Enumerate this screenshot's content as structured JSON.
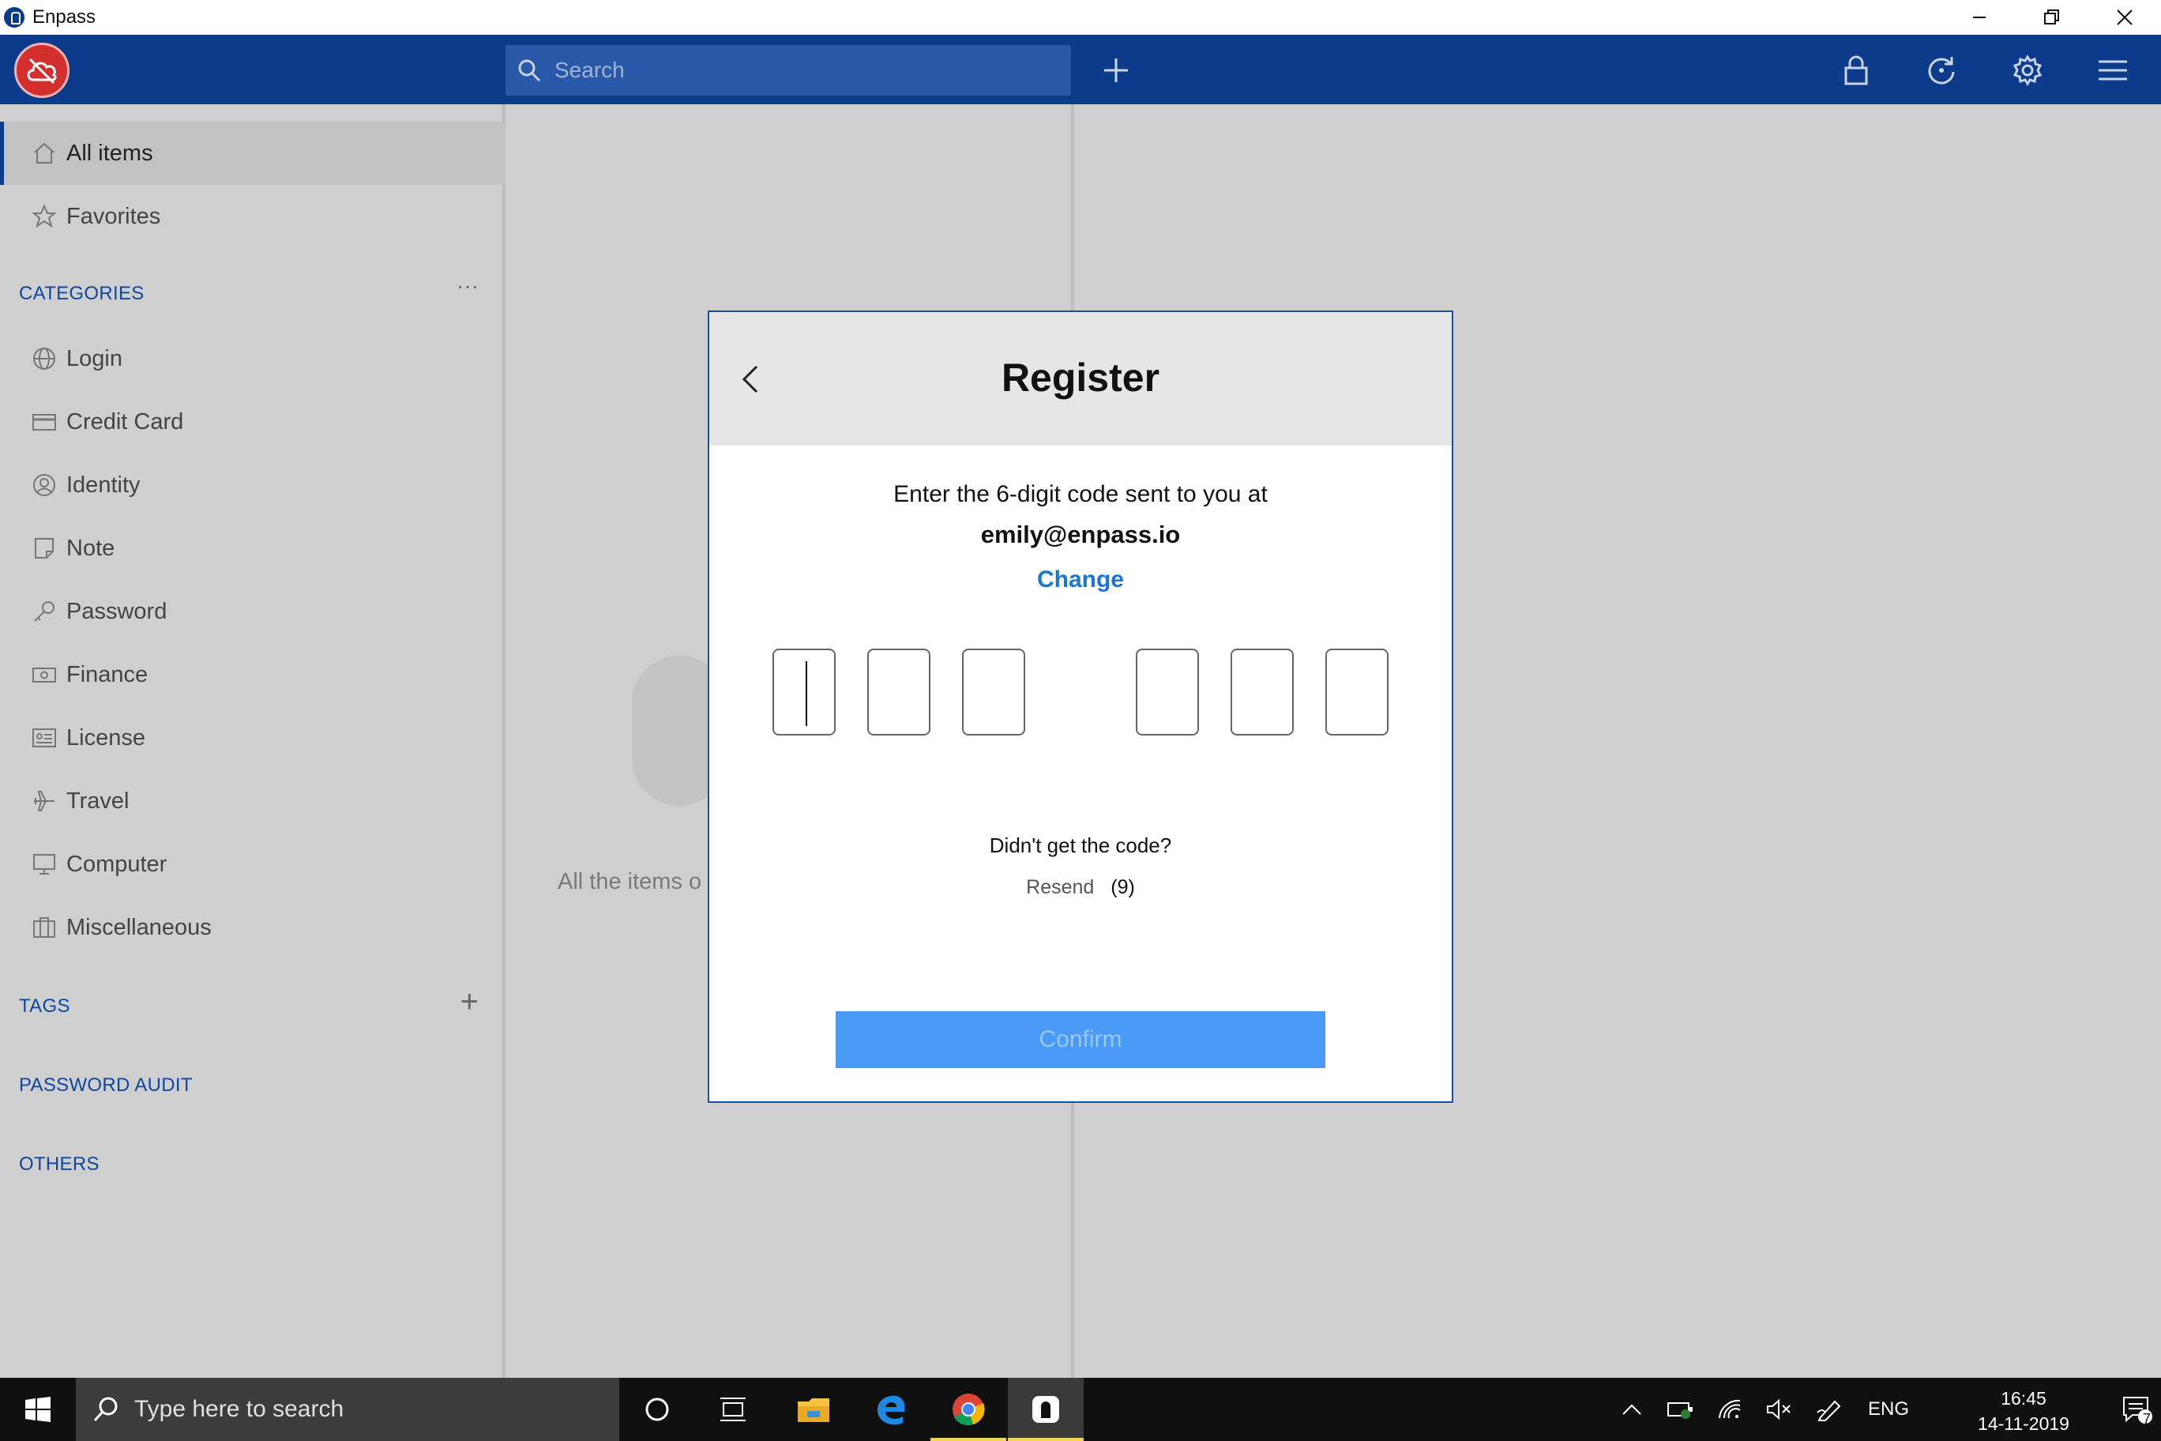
{
  "window": {
    "title": "Enpass"
  },
  "header": {
    "search_placeholder": "Search"
  },
  "sidebar": {
    "top_items": [
      {
        "label": "All items",
        "icon": "home-icon"
      },
      {
        "label": "Favorites",
        "icon": "star-icon"
      }
    ],
    "categories_header": "CATEGORIES",
    "categories_more": "···",
    "categories": [
      {
        "label": "Login",
        "icon": "globe-icon"
      },
      {
        "label": "Credit Card",
        "icon": "credit-card-icon"
      },
      {
        "label": "Identity",
        "icon": "identity-icon"
      },
      {
        "label": "Note",
        "icon": "note-icon"
      },
      {
        "label": "Password",
        "icon": "key-icon"
      },
      {
        "label": "Finance",
        "icon": "finance-icon"
      },
      {
        "label": "License",
        "icon": "license-icon"
      },
      {
        "label": "Travel",
        "icon": "plane-icon"
      },
      {
        "label": "Computer",
        "icon": "monitor-icon"
      },
      {
        "label": "Miscellaneous",
        "icon": "briefcase-icon"
      }
    ],
    "tags_header": "TAGS",
    "tags_add": "+",
    "password_audit_header": "PASSWORD AUDIT",
    "others_header": "OTHERS"
  },
  "middle": {
    "empty_text": "All the items o"
  },
  "dialog": {
    "title": "Register",
    "instruction": "Enter the 6-digit code sent to you at",
    "email": "emily@enpass.io",
    "change_link": "Change",
    "code_digits": [
      "",
      "",
      "",
      "",
      "",
      ""
    ],
    "no_code_text": "Didn't get the code?",
    "resend_label": "Resend",
    "resend_countdown": "(9)",
    "confirm_label": "Confirm"
  },
  "taskbar": {
    "search_placeholder": "Type here to search",
    "language": "ENG",
    "time": "16:45",
    "date": "14-11-2019",
    "notification_count": "7"
  },
  "colors": {
    "header_blue": "#0d3b8c",
    "accent_blue": "#1976d2",
    "confirm_blue": "#4a9bf5",
    "logo_red": "#d32f2f"
  }
}
